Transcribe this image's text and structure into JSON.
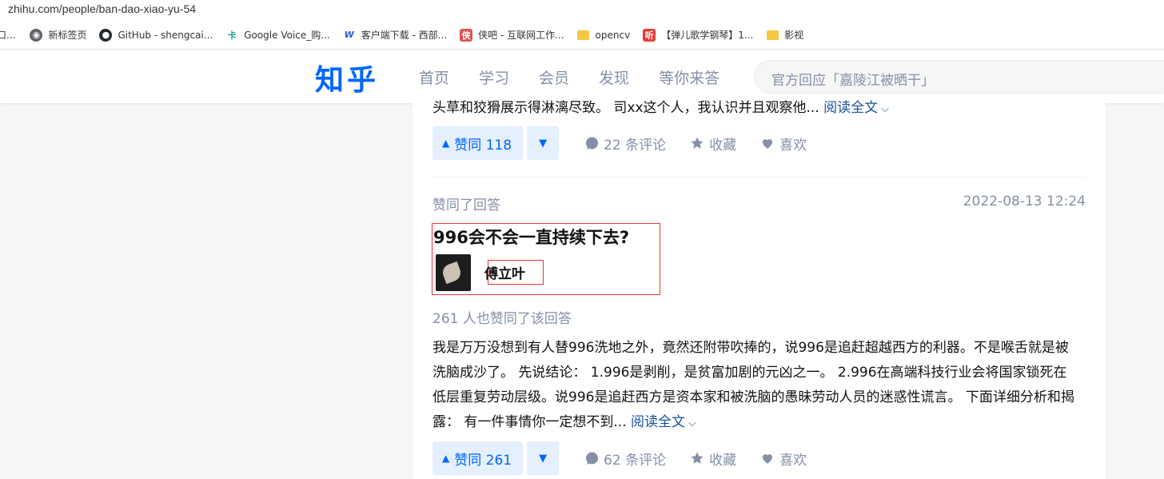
{
  "browser": {
    "url": "zhihu.com/people/ban-dao-xiao-yu-54",
    "bookmarks": [
      {
        "label": "口...",
        "icon": "app-icon"
      },
      {
        "label": "新标签页",
        "icon": "globe-icon"
      },
      {
        "label": "GitHub - shengcai...",
        "icon": "github-icon"
      },
      {
        "label": "Google Voice_购...",
        "icon": "card-icon"
      },
      {
        "label": "客户端下载 - 西部...",
        "icon": "w-icon"
      },
      {
        "label": "侠吧 - 互联网工作...",
        "icon": "xiaba-icon"
      },
      {
        "label": "opencv",
        "icon": "folder-icon"
      },
      {
        "label": "【弹儿歌学钢琴】1...",
        "icon": "listen-icon"
      },
      {
        "label": "影视",
        "icon": "folder-icon"
      }
    ]
  },
  "header": {
    "logo": "知乎",
    "nav": [
      "首页",
      "学习",
      "会员",
      "发现",
      "等你来答"
    ],
    "search_placeholder": "官方回应「嘉陵江被晒干」"
  },
  "feed": {
    "item1": {
      "excerpt": "头草和狡猾展示得淋漓尽致。 司xx这个人，我认识并且观察他...",
      "read_more": "阅读全文",
      "upvote": "赞同 118",
      "comments": "22 条评论",
      "collect": "收藏",
      "like": "喜欢"
    },
    "item2": {
      "action_label": "赞同了回答",
      "timestamp": "2022-08-13 12:24",
      "question_title": "996会不会一直持续下去?",
      "author": "傅立叶",
      "vote_count_text": "261 人也赞同了该回答",
      "excerpt": "我是万万没想到有人替996洗地之外，竟然还附带吹捧的，说996是追赶超越西方的利器。不是喉舌就是被洗脑成沙了。 先说结论： 1.996是剥削，是贫富加剧的元凶之一。 2.996在高端科技行业会将国家锁死在低层重复劳动层级。说996是追赶西方是资本家和被洗脑的愚昧劳动人员的迷惑性谎言。 下面详细分析和揭露： 有一件事情你一定想不到...",
      "read_more": "阅读全文",
      "upvote": "赞同 261",
      "comments": "62 条评论",
      "collect": "收藏",
      "like": "喜欢"
    }
  },
  "colors": {
    "brand": "#0066ff",
    "muted": "#8590a6",
    "link": "#175199",
    "highlight_box": "#e53935"
  }
}
